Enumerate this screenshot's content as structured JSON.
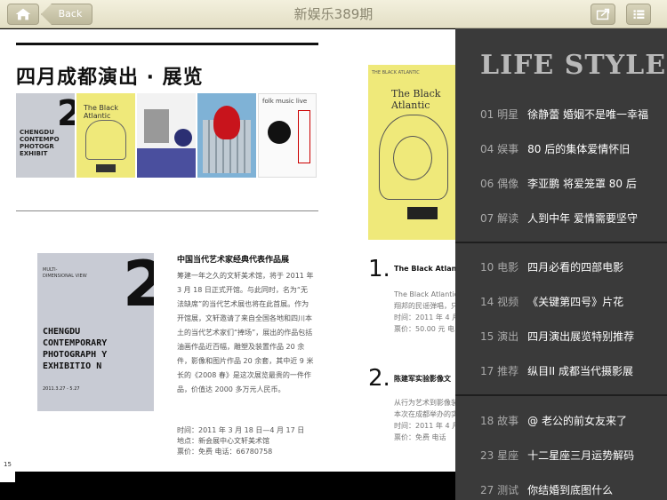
{
  "topbar": {
    "back_label": "Back",
    "title": "新娱乐389期"
  },
  "page": {
    "title": "四月成都演出 · 展览",
    "item1": {
      "heading": "中国当代艺术家经典代表作品展",
      "body": "筹建一年之久的文轩美术馆，将于 2011 年 3 月 18 日正式开馆。与此同时，名为“无法缺席”的当代艺术展也将在此首展。作为开馆展，文轩邀请了来自全国各地和四川本土的当代艺术家们“捧场”，展出的作品包括油画作品近百幅，雕塑及装置作品 20 余件，影像和图片作品 20 余套，其中近 9 米长的《2008 春》是这次展览最贵的一件作品，价值达 2000 多万元人民币。",
      "time": "时间：2011 年 3 月 18 日—4 月 17 日",
      "location": "地点：新会展中心文轩美术馆",
      "ticket": "票价：免费    电话：66780758"
    },
    "poster_text": {
      "line1": "MULTI-",
      "line2": "DIMENSIONAL VIEW",
      "big": [
        "CHENGDU",
        "CONTEMPORARY",
        "PHOTOGRAPH Y",
        "EXHIBITIO  N"
      ],
      "date": "2011.3.27 - 5.27"
    },
    "list1": {
      "num": "1.",
      "heading": "The Black Atlantic",
      "line1": "The Black Atlantic 是",
      "line2": "翔邦的民谣弹唱，只",
      "line3": "时间：2011 年 4 月",
      "line4": "票价：50.00 元     电"
    },
    "list2": {
      "num": "2.",
      "heading": "陈建军实验影像文",
      "line1": "从行为艺术到影像装",
      "line2": "本次在成都举办的实",
      "line3": "时间：2011 年 4 月",
      "line4": "票价：免费       电话"
    },
    "thumb_caption": "The Black Atlantic",
    "page_number": "15"
  },
  "panel": {
    "title": "LIFE STYLE",
    "groups": [
      [
        {
          "num": "01",
          "category": "明星",
          "title": "徐静蕾 婚姻不是唯一幸福"
        },
        {
          "num": "04",
          "category": "娱事",
          "title": "80 后的集体爱情怀旧"
        },
        {
          "num": "06",
          "category": "偶像",
          "title": "李亚鹏 将爱笼罩 80 后"
        },
        {
          "num": "07",
          "category": "解读",
          "title": "人到中年 爱情需要坚守"
        }
      ],
      [
        {
          "num": "10",
          "category": "电影",
          "title": "四月必看的四部电影"
        },
        {
          "num": "14",
          "category": "视频",
          "title": "《关键第四号》片花"
        },
        {
          "num": "15",
          "category": "演出",
          "title": "四月演出展览特别推荐"
        },
        {
          "num": "17",
          "category": "推荐",
          "title": "纵目II 成都当代摄影展"
        }
      ],
      [
        {
          "num": "18",
          "category": "故事",
          "title": "@ 老公的前女友来了"
        },
        {
          "num": "23",
          "category": "星座",
          "title": "十二星座三月运势解码"
        },
        {
          "num": "27",
          "category": "测试",
          "title": "你结婚到底图什么"
        }
      ]
    ]
  }
}
